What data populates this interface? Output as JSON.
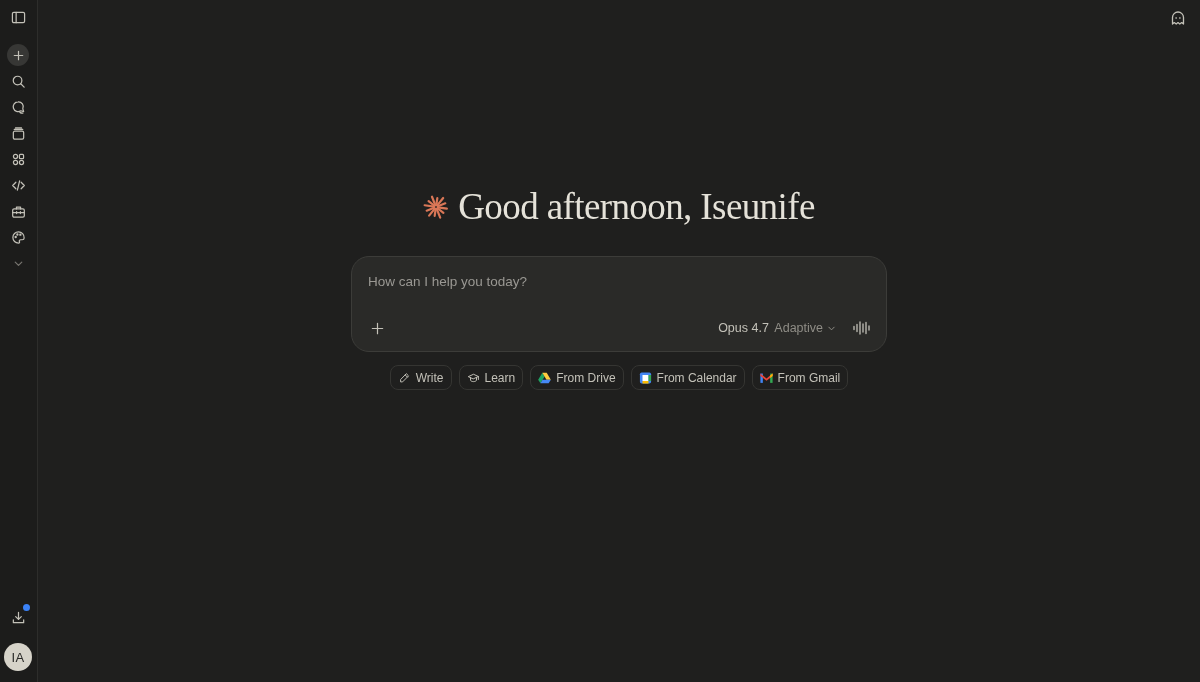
{
  "sidebar": {
    "download": {
      "notification": true
    },
    "avatar": {
      "initials": "IA"
    }
  },
  "greeting": "Good afternoon, Iseunife",
  "composer": {
    "placeholder": "How can I help you today?",
    "model": "Opus 4.7",
    "mode": "Adaptive"
  },
  "suggestions": [
    {
      "label": "Write",
      "kind": "pencil"
    },
    {
      "label": "Learn",
      "kind": "cap"
    },
    {
      "label": "From Drive",
      "kind": "drive"
    },
    {
      "label": "From Calendar",
      "kind": "calendar"
    },
    {
      "label": "From Gmail",
      "kind": "gmail"
    }
  ]
}
